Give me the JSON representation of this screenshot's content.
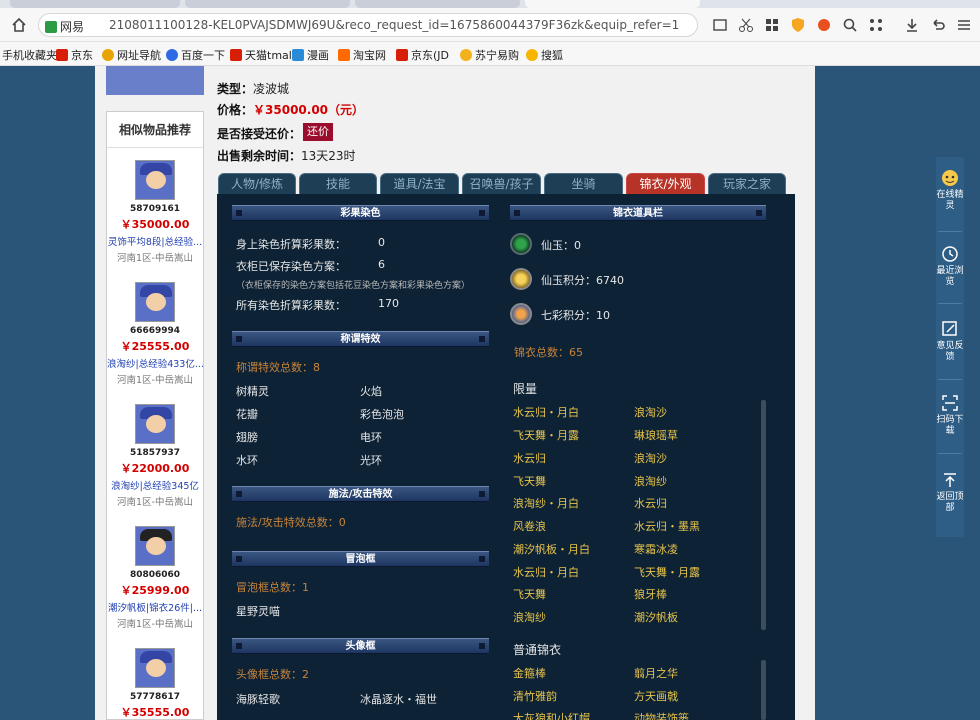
{
  "browser": {
    "url_site": "网易",
    "url": "2108011100128-KEL0PVAJSDMWJ69U&reco_request_id=1675860044379F36zk&equip_refer=1",
    "bookmarks": [
      "手机收藏夹",
      "京东",
      "网址导航",
      "百度一下",
      "天猫tmall",
      "漫画",
      "淘宝网",
      "京东(JD",
      "苏宁易购",
      "搜狐"
    ]
  },
  "item_info": {
    "type_label": "类型：",
    "type_value": "凌波城",
    "price_label": "价格：",
    "price_value": "￥35000.00（元）",
    "bargain_label": "是否接受还价：",
    "bargain_button": "还价",
    "time_label": "出售剩余时间：",
    "time_value": "13天23时"
  },
  "recommend": {
    "title": "相似物品推荐",
    "items": [
      {
        "id": "58709161",
        "price": "￥35000.00",
        "desc": "灵饰平均8段|总经验...",
        "server": "河南1区-中岳嵩山"
      },
      {
        "id": "66669994",
        "price": "￥25555.00",
        "desc": "浪淘纱|总经验433亿...",
        "server": "河南1区-中岳嵩山"
      },
      {
        "id": "51857937",
        "price": "￥22000.00",
        "desc": "浪淘纱|总经验345亿",
        "server": "河南1区-中岳嵩山"
      },
      {
        "id": "80806060",
        "price": "￥25999.00",
        "desc": "潮汐帆板|锦衣26件|...",
        "server": "河南1区-中岳嵩山"
      },
      {
        "id": "57778617",
        "price": "￥35555.00",
        "desc": "",
        "server": ""
      }
    ]
  },
  "tabs": [
    "人物/修炼",
    "技能",
    "道具/法宝",
    "召唤兽/孩子",
    "坐骑",
    "锦衣/外观",
    "玩家之家"
  ],
  "panel": {
    "dye": {
      "header": "彩果染色",
      "rows": [
        {
          "label": "身上染色折算彩果数：",
          "value": "0"
        },
        {
          "label": "衣柜已保存染色方案：",
          "value": "6"
        },
        {
          "label": "所有染色折算彩果数：",
          "value": "170"
        }
      ],
      "note": "（衣柜保存的染色方案包括花豆染色方案和彩果染色方案）"
    },
    "title_fx": {
      "header": "称谓特效",
      "total": "称谓特效总数：8",
      "items": [
        "树精灵",
        "火焰",
        "花瓣",
        "彩色泡泡",
        "翅膀",
        "电环",
        "水环",
        "光环"
      ]
    },
    "cast_fx": {
      "header": "施法/攻击特效",
      "total": "施法/攻击特效总数：0"
    },
    "bubble": {
      "header": "冒泡框",
      "total": "冒泡框总数：1",
      "items": [
        "星野灵喵"
      ]
    },
    "avatar_frame": {
      "header": "头像框",
      "total": "头像框总数：2",
      "items": [
        "海豚轻歌",
        "冰晶逐水・福世"
      ]
    },
    "wardrobe": {
      "header": "锦衣道具栏",
      "currencies": [
        {
          "icon": "jade-coin-icon",
          "label": "仙玉：0"
        },
        {
          "icon": "jade-points-icon",
          "label": "仙玉积分：6740"
        },
        {
          "icon": "rainbow-points-icon",
          "label": "七彩积分：10"
        }
      ],
      "total": "锦衣总数：65",
      "limited_title": "限量",
      "limited": [
        "水云归・月白",
        "浪淘沙",
        "飞天舞・月露",
        "琳琅瑶草",
        "水云归",
        "浪淘沙",
        "飞天舞",
        "浪淘纱",
        "浪淘纱・月白",
        "水云归",
        "风卷浪",
        "水云归・墨黑",
        "潮汐帆板・月白",
        "寒霜冰凌",
        "水云归・月白",
        "飞天舞・月露",
        "飞天舞",
        "狼牙棒",
        "浪淘纱",
        "潮汐帆板"
      ],
      "normal_title": "普通锦衣",
      "normal": [
        "金箍棒",
        "翦月之华",
        "清竹雅韵",
        "方天画戟",
        "大灰狼和小红帽",
        "动物装饰篓"
      ]
    }
  },
  "sidebar": [
    {
      "icon": "assistant-icon",
      "label": "在线精灵"
    },
    {
      "icon": "clock-icon",
      "label": "最近浏览"
    },
    {
      "icon": "feedback-icon",
      "label": "意见反馈"
    },
    {
      "icon": "scan-icon",
      "label": "扫码下载"
    },
    {
      "icon": "back-to-top-icon",
      "label": "返回顶部"
    }
  ],
  "colors": {
    "panel_bg": "#0d2235",
    "active_tab": "#b83327",
    "price_red": "#d30000",
    "orange_text": "#c88439"
  }
}
